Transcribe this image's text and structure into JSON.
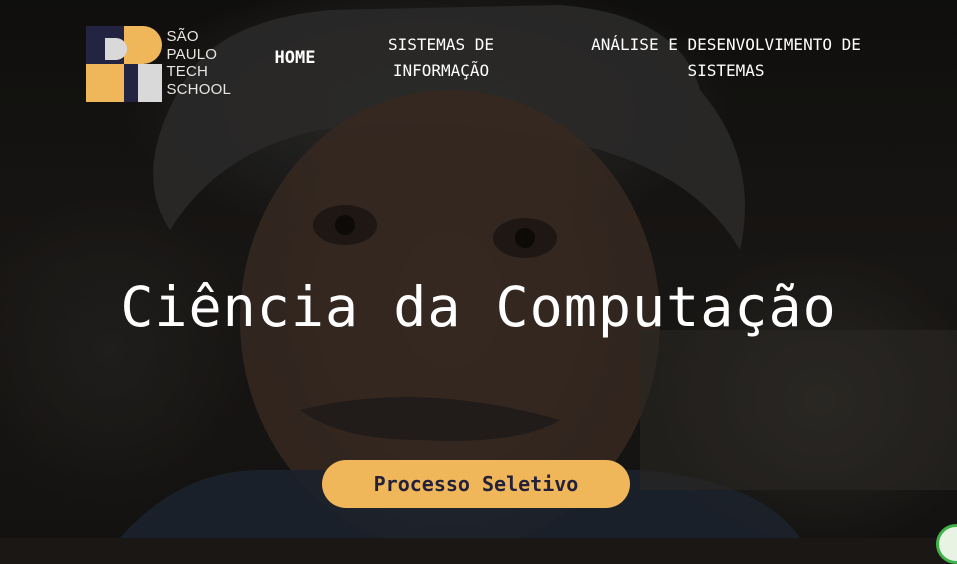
{
  "brand": {
    "logo_lines": [
      "SÃO",
      "PAULO",
      "TECH",
      "SCHOOL"
    ],
    "colors": {
      "navy": "#232342",
      "gold": "#f0b65a",
      "light": "#d9d9d9"
    }
  },
  "nav": {
    "home": "HOME",
    "sistemas_informacao": "SISTEMAS DE INFORMAÇÃO",
    "ads": "ANÁLISE E DESENVOLVIMENTO DE SISTEMAS"
  },
  "hero": {
    "title": "Ciência da Computação",
    "cta_label": "Processo Seletivo"
  },
  "colors": {
    "accent": "#f0b65a",
    "cta_text": "#23213a",
    "text": "#ffffff"
  }
}
